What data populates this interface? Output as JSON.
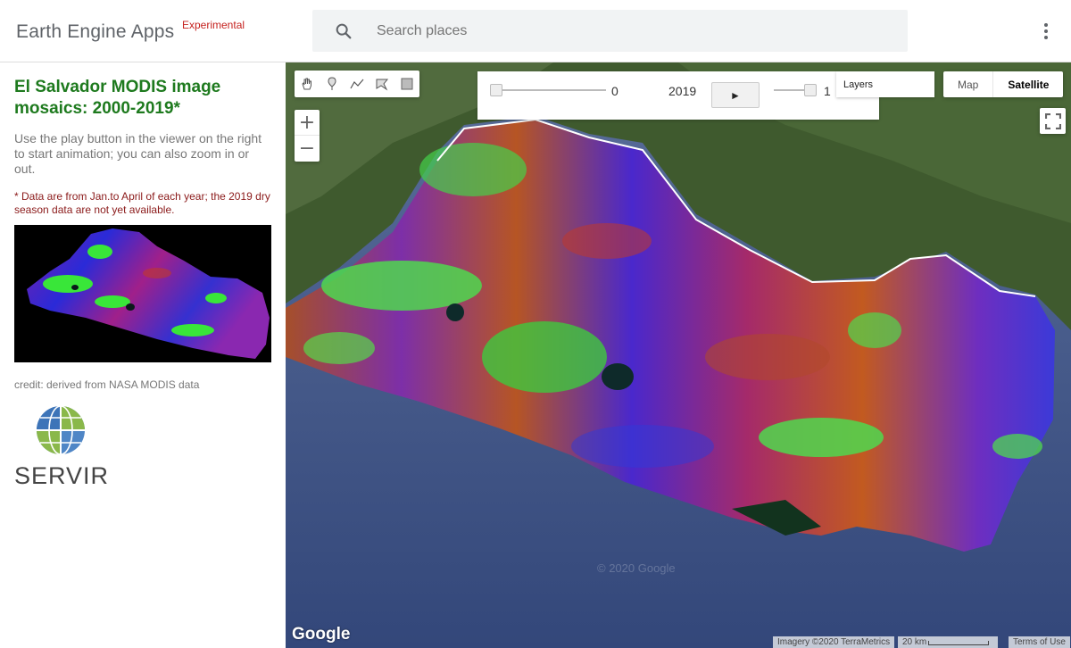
{
  "app": {
    "title": "Earth Engine Apps",
    "badge": "Experimental"
  },
  "search": {
    "placeholder": "Search places"
  },
  "panel": {
    "title": "El Salvador MODIS image mosaics: 2000-2019*",
    "description": "Use the play button in the viewer on the right to start animation; you can also zoom in or out.",
    "note": "* Data are from Jan.to April of each year; the 2019 dry season data are not yet available.",
    "credit": "credit: derived from NASA MODIS data",
    "logo_text": "SERVIR"
  },
  "map": {
    "slider_value": "0",
    "year": "2019",
    "play_label": "►",
    "opacity_value": "1",
    "layers_label": "Layers",
    "map_type_map": "Map",
    "map_type_satellite": "Satellite",
    "zoom_in": "+",
    "zoom_out": "−",
    "google_logo": "Google",
    "watermark": "© 2020 Google",
    "imagery_attr": "Imagery ©2020 TerraMetrics",
    "scale": "20 km",
    "terms": "Terms of Use",
    "active_map_type": "Satellite"
  },
  "icons": {
    "search": "search-icon",
    "more": "more-vert-icon",
    "draw_tools": [
      "hand-icon",
      "marker-icon",
      "polyline-icon",
      "polygon-icon",
      "rectangle-icon"
    ],
    "fullscreen": "fullscreen-icon"
  },
  "colors": {
    "title_green": "#1e7a1e",
    "note_red": "#8b1a1a",
    "badge_red": "#c5221f"
  }
}
